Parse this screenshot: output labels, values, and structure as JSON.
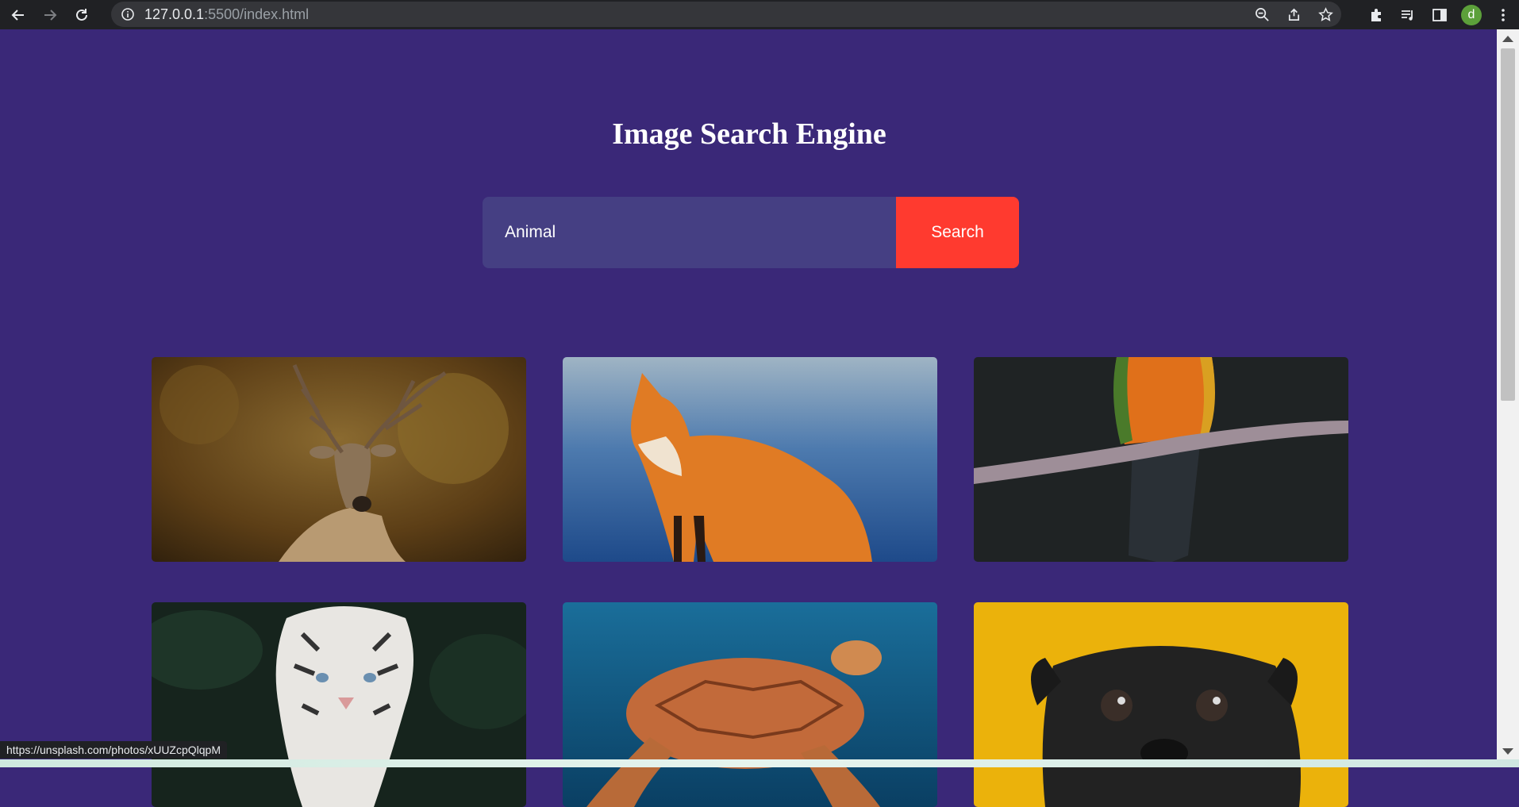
{
  "browser": {
    "url_host": "127.0.0.1",
    "url_rest": ":5500/index.html",
    "avatar_letter": "d",
    "status_url": "https://unsplash.com/photos/xUUZcpQlqpM"
  },
  "page": {
    "title": "Image Search Engine",
    "search": {
      "value": "Animal",
      "button_label": "Search"
    },
    "results": [
      {
        "subject": "deer",
        "bg": "#6b4a1c"
      },
      {
        "subject": "fox",
        "bg": "#5a7fa6"
      },
      {
        "subject": "parrot",
        "bg": "#202425"
      },
      {
        "subject": "white tiger",
        "bg": "#1b2a22"
      },
      {
        "subject": "sea turtle",
        "bg": "#0e5e88"
      },
      {
        "subject": "pug",
        "bg": "#e8b20a"
      }
    ]
  },
  "colors": {
    "background": "#3a2878",
    "input_bg": "#453f83",
    "button_bg": "#ff3a2f"
  }
}
